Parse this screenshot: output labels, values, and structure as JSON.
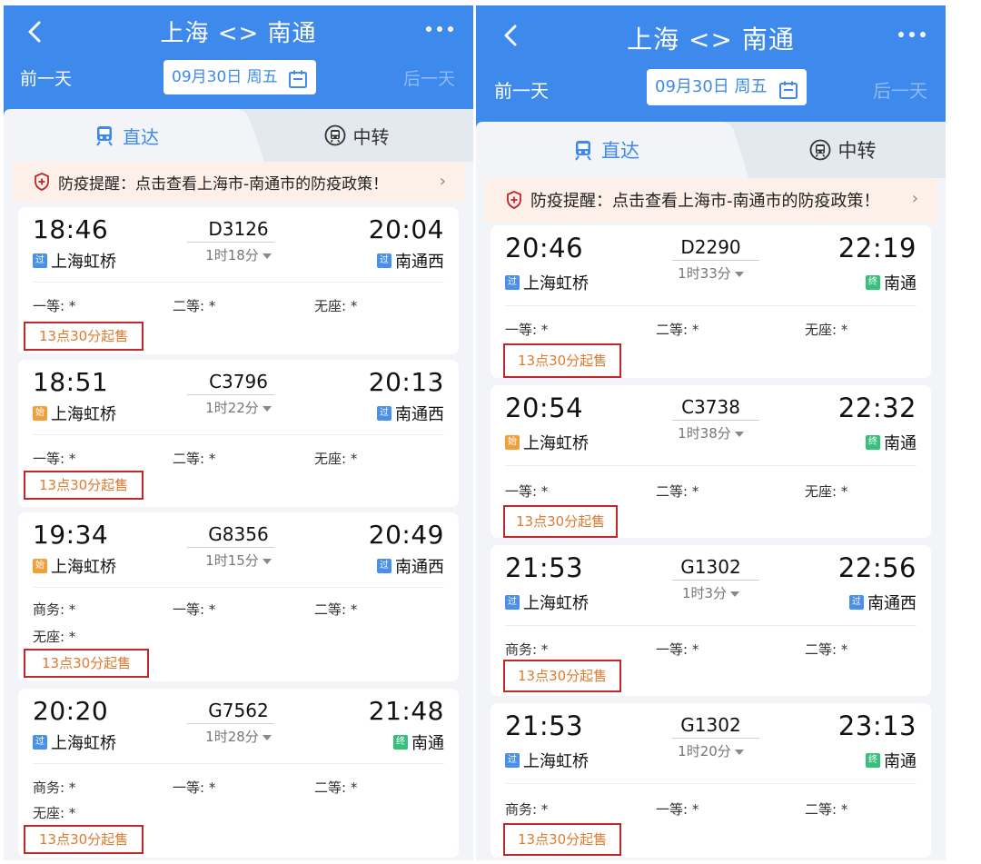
{
  "panels": [
    {
      "header": {
        "title": "上海 <> 南通",
        "prev_day": "前一天",
        "date": "09月30日 周五",
        "next_day": "后一天"
      },
      "tabs": [
        {
          "label": "直达"
        },
        {
          "label": "中转"
        }
      ],
      "notice": "防疫提醒：点击查看上海市-南通市的防疫政策！",
      "cards": [
        {
          "dep_time": "18:46",
          "arr_time": "20:04",
          "train": "D3126",
          "duration": "1时18分",
          "dep_station": "上海虹桥",
          "arr_station": "南通西",
          "dep_badge": "过",
          "arr_badge": "过",
          "seats": [
            "一等: *",
            "二等: *",
            "无座: *"
          ],
          "sale": "13点30分起售"
        },
        {
          "dep_time": "18:51",
          "arr_time": "20:13",
          "train": "C3796",
          "duration": "1时22分",
          "dep_station": "上海虹桥",
          "arr_station": "南通西",
          "dep_badge": "始",
          "arr_badge": "过",
          "seats": [
            "一等: *",
            "二等: *",
            "无座: *"
          ],
          "sale": "13点30分起售"
        },
        {
          "dep_time": "19:34",
          "arr_time": "20:49",
          "train": "G8356",
          "duration": "1时15分",
          "dep_station": "上海虹桥",
          "arr_station": "南通西",
          "dep_badge": "始",
          "arr_badge": "过",
          "seats": [
            "商务: *",
            "一等: *",
            "二等: *",
            "无座: *"
          ],
          "sale": "13点30分起售"
        },
        {
          "dep_time": "20:20",
          "arr_time": "21:48",
          "train": "G7562",
          "duration": "1时28分",
          "dep_station": "上海虹桥",
          "arr_station": "南通",
          "dep_badge": "过",
          "arr_badge": "终",
          "seats": [
            "商务: *",
            "一等: *",
            "二等: *",
            "无座: *"
          ],
          "sale": "13点30分起售"
        }
      ]
    },
    {
      "header": {
        "title": "上海 <> 南通",
        "prev_day": "前一天",
        "date": "09月30日 周五",
        "next_day": "后一天"
      },
      "tabs": [
        {
          "label": "直达"
        },
        {
          "label": "中转"
        }
      ],
      "notice": "防疫提醒：点击查看上海市-南通市的防疫政策！",
      "cards": [
        {
          "dep_time": "20:46",
          "arr_time": "22:19",
          "train": "D2290",
          "duration": "1时33分",
          "dep_station": "上海虹桥",
          "arr_station": "南通",
          "dep_badge": "过",
          "arr_badge": "终",
          "seats": [
            "一等: *",
            "二等: *",
            "无座: *"
          ],
          "sale": "13点30分起售"
        },
        {
          "dep_time": "20:54",
          "arr_time": "22:32",
          "train": "C3738",
          "duration": "1时38分",
          "dep_station": "上海虹桥",
          "arr_station": "南通",
          "dep_badge": "始",
          "arr_badge": "终",
          "seats": [
            "一等: *",
            "二等: *",
            "无座: *"
          ],
          "sale": "13点30分起售"
        },
        {
          "dep_time": "21:53",
          "arr_time": "22:56",
          "train": "G1302",
          "duration": "1时3分",
          "dep_station": "上海虹桥",
          "arr_station": "南通西",
          "dep_badge": "过",
          "arr_badge": "过",
          "seats": [
            "商务: *",
            "一等: *",
            "二等: *"
          ],
          "sale": "13点30分起售"
        },
        {
          "dep_time": "21:53",
          "arr_time": "23:13",
          "train": "G1302",
          "duration": "1时20分",
          "dep_station": "上海虹桥",
          "arr_station": "南通",
          "dep_badge": "过",
          "arr_badge": "终",
          "seats": [
            "商务: *",
            "一等: *",
            "二等: *"
          ],
          "sale": "13点30分起售"
        }
      ]
    }
  ],
  "colors": {
    "header_blue": "#3d89ec",
    "sale_border": "#c0282a",
    "sale_text": "#e07a2e",
    "notice_bg": "#fdf0e8"
  },
  "icons": {
    "back": "chevron-left-icon",
    "more": "more-dots-icon",
    "calendar": "calendar-icon",
    "direct": "train-icon",
    "transfer": "transfer-train-icon",
    "notice": "shield-icon",
    "notice_arrow": "chevron-right-icon"
  }
}
